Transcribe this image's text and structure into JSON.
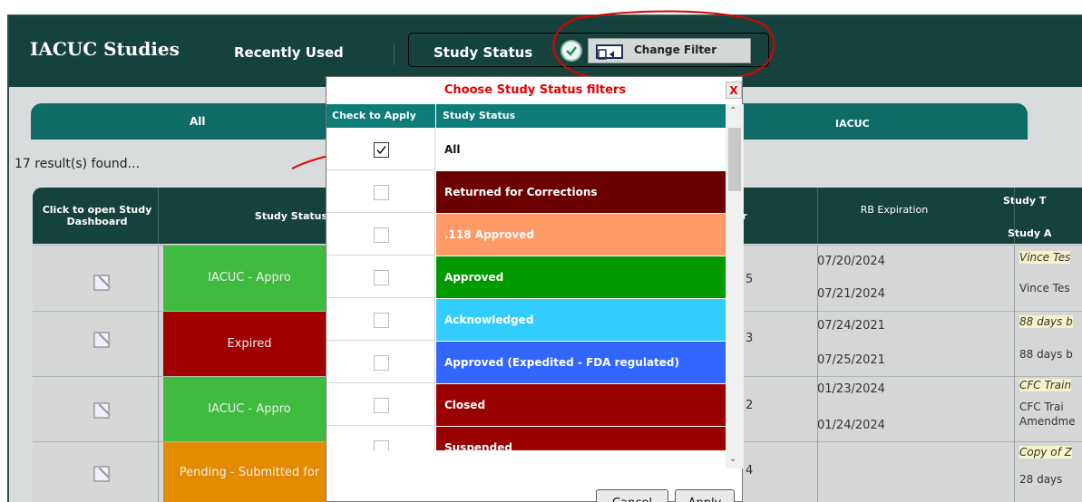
{
  "header": {
    "app_title": "IACUC Studies",
    "recently_used": "Recently Used",
    "study_status_label": "Study Status",
    "change_filter_label": "Change Filter"
  },
  "tabs": [
    {
      "label": "All"
    },
    {
      "label": "IACUC"
    }
  ],
  "results_text": "17 result(s) found...",
  "table": {
    "headers": {
      "open": "Click to open Study Dashboard",
      "status": "Study Status",
      "number_fragment": "r",
      "rb_expiration": "RB Expiration",
      "study_t": "Study T",
      "study_a": "Study A"
    },
    "rows": [
      {
        "status": "IACUC - Appro",
        "status_color": "#3fbb3f",
        "num": "5",
        "date1": "07/20/2024",
        "date2": "07/21/2024",
        "right1": "Vince Tes",
        "right2": "Vince Tes"
      },
      {
        "status": "Expired",
        "status_color": "#a00000",
        "num": "3",
        "date1": "07/24/2021",
        "date2": "07/25/2021",
        "right1": "88 days b",
        "right2": "88 days b"
      },
      {
        "status": "IACUC - Appro",
        "status_color": "#3fbb3f",
        "num": "2",
        "date1": "01/23/2024",
        "date2": "01/24/2024",
        "right1": "CFC Train",
        "right2": "CFC Trai",
        "right3": "Amendme"
      },
      {
        "status": "Pending - Submitted for",
        "status_color": "#e28a00",
        "num": "4",
        "date1": "",
        "date2": "",
        "right1": "Copy of Z",
        "right2": "28 days"
      }
    ]
  },
  "modal": {
    "title": "Choose Study Status filters",
    "close_label": "X",
    "col_check": "Check to Apply",
    "col_status": "Study Status",
    "statuses": [
      {
        "name": "All",
        "bg": "#ffffff",
        "fg": "#111111",
        "checked": true
      },
      {
        "name": "Returned for Corrections",
        "bg": "#6b0000",
        "fg": "#ffffff",
        "checked": false
      },
      {
        "name": ".118 Approved",
        "bg": "#ff9966",
        "fg": "#ffffff",
        "checked": false
      },
      {
        "name": "Approved",
        "bg": "#009900",
        "fg": "#ffffff",
        "checked": false
      },
      {
        "name": "Acknowledged",
        "bg": "#33ccff",
        "fg": "#ffffff",
        "checked": false
      },
      {
        "name": "Approved (Expedited - FDA regulated)",
        "bg": "#3366ff",
        "fg": "#ffffff",
        "checked": false
      },
      {
        "name": "Closed",
        "bg": "#990000",
        "fg": "#ffffff",
        "checked": false
      },
      {
        "name": "Suspended",
        "bg": "#990000",
        "fg": "#ffffff",
        "checked": false
      }
    ],
    "cancel_label": "Cancel",
    "apply_label": "Apply"
  }
}
